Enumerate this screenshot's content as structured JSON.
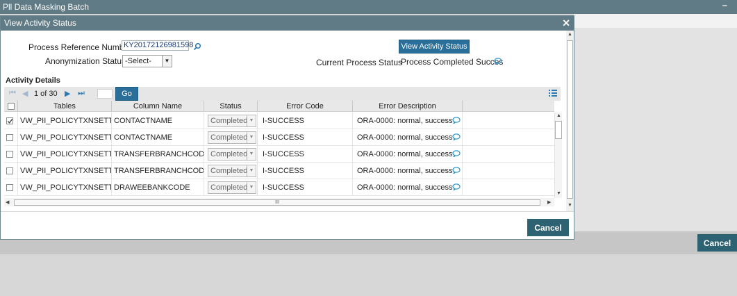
{
  "background": {
    "title": "Pll Data Masking Batch",
    "minimize": "–",
    "cancel_label": "Cancel"
  },
  "modal": {
    "title": "View Activity Status",
    "close": "✕",
    "fields": {
      "process_ref_label": "Process Reference Number",
      "process_ref_value": "KY20172126981598",
      "anon_status_label": "Anonymization Status",
      "anon_status_value": "-Select-",
      "current_status_label": "Current  Process Status",
      "current_status_value": "Process Completed Succes"
    },
    "view_status_button": "View Activity Status",
    "section_title": "Activity Details",
    "pager": {
      "page_text": "1 of 30",
      "go_label": "Go"
    },
    "columns": [
      "Tables",
      "Column Name",
      "Status",
      "Error Code",
      "Error Description"
    ],
    "rows": [
      {
        "checked": true,
        "table": "VW_PII_POLICYTXNSETTLI",
        "column": "CONTACTNAME",
        "status": "Completed",
        "error_code": "I-SUCCESS",
        "error_desc": "ORA-0000: normal, success"
      },
      {
        "checked": false,
        "table": "VW_PII_POLICYTXNSETTLI",
        "column": "CONTACTNAME",
        "status": "Completed",
        "error_code": "I-SUCCESS",
        "error_desc": "ORA-0000: normal, success"
      },
      {
        "checked": false,
        "table": "VW_PII_POLICYTXNSETTLI",
        "column": "TRANSFERBRANCHCODE",
        "status": "Completed",
        "error_code": "I-SUCCESS",
        "error_desc": "ORA-0000: normal, success"
      },
      {
        "checked": false,
        "table": "VW_PII_POLICYTXNSETTLI",
        "column": "TRANSFERBRANCHCODE",
        "status": "Completed",
        "error_code": "I-SUCCESS",
        "error_desc": "ORA-0000: normal, success"
      },
      {
        "checked": false,
        "table": "VW_PII_POLICYTXNSETTLI",
        "column": "DRAWEEBANKCODE",
        "status": "Completed",
        "error_code": "I-SUCCESS",
        "error_desc": "ORA-0000: normal, success"
      }
    ],
    "hscroll_grip": "III",
    "cancel_label": "Cancel"
  },
  "colors": {
    "titlebar": "#607b85",
    "button_blue": "#2a6f9a",
    "cancel_teal": "#2d6273"
  },
  "icons": {
    "search": "search-icon",
    "bubble": "speech-bubble-icon"
  }
}
